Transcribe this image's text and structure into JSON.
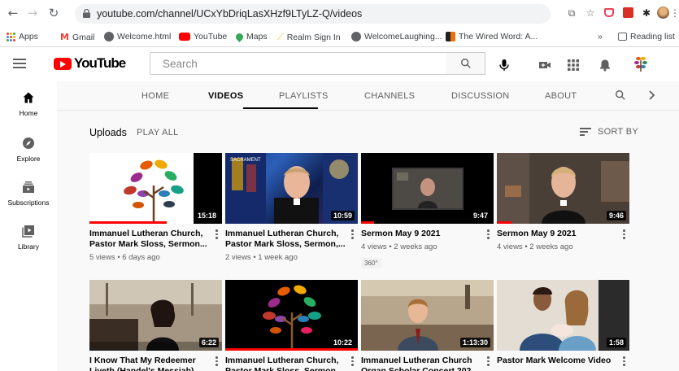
{
  "browser": {
    "url": "youtube.com/channel/UCxYbDriqLasXHzf9LTyLZ-Q/videos",
    "bookmarks": [
      {
        "label": "Apps",
        "color": "#4285f4"
      },
      {
        "label": "Gmail",
        "color": "#ea4335"
      },
      {
        "label": "Welcome.html",
        "color": "#5f6368"
      },
      {
        "label": "YouTube",
        "color": "#ff0000"
      },
      {
        "label": "Maps",
        "color": "#34a853"
      },
      {
        "label": "Realm Sign In",
        "color": "#fbbc04"
      },
      {
        "label": "WelcomeLaughing...",
        "color": "#5f6368"
      },
      {
        "label": "The Wired Word: A...",
        "color": "#e8710a"
      }
    ],
    "more_bookmarks": "»",
    "reading_list": "Reading list"
  },
  "youtube": {
    "logo_text": "YouTube",
    "search_placeholder": "Search",
    "sidebar": [
      {
        "label": "Home",
        "icon": "home-icon"
      },
      {
        "label": "Explore",
        "icon": "compass-icon"
      },
      {
        "label": "Subscriptions",
        "icon": "subscriptions-icon"
      },
      {
        "label": "Library",
        "icon": "library-icon"
      }
    ],
    "tabs": [
      {
        "label": "HOME",
        "active": false
      },
      {
        "label": "VIDEOS",
        "active": true
      },
      {
        "label": "PLAYLISTS",
        "active": false
      },
      {
        "label": "CHANNELS",
        "active": false
      },
      {
        "label": "DISCUSSION",
        "active": false
      },
      {
        "label": "ABOUT",
        "active": false
      }
    ],
    "section_title": "Uploads",
    "play_all": "PLAY ALL",
    "sort_by": "SORT BY",
    "videos": [
      {
        "title": "Immanuel Lutheran Church, Pastor Mark Sloss, Sermon...",
        "meta": "5 views • 6 days ago",
        "duration": "15:18",
        "watched": 0.58,
        "badge": ""
      },
      {
        "title": "Immanuel Lutheran Church, Pastor Mark Sloss, Sermon,...",
        "meta": "2 views • 1 week ago",
        "duration": "10:59",
        "watched": 0.0,
        "badge": ""
      },
      {
        "title": "Sermon May 9 2021",
        "meta": "4 views • 2 weeks ago",
        "duration": "9:47",
        "watched": 0.1,
        "badge": "360°"
      },
      {
        "title": "Sermon May 9 2021",
        "meta": "4 views • 2 weeks ago",
        "duration": "9:46",
        "watched": 0.11,
        "badge": ""
      },
      {
        "title": "I Know That My Redeemer Liveth (Handel's Messiah)",
        "meta": "",
        "duration": "6:22",
        "watched": 0.0,
        "badge": ""
      },
      {
        "title": "Immanuel Lutheran Church, Pastor Mark Sloss, Sermon,...",
        "meta": "",
        "duration": "10:22",
        "watched": 1.0,
        "badge": ""
      },
      {
        "title": "Immanuel Lutheran Church Organ Scholar Concert 202...",
        "meta": "",
        "duration": "1:13:30",
        "watched": 0.0,
        "badge": ""
      },
      {
        "title": "Pastor Mark Welcome Video",
        "meta": "",
        "duration": "1:58",
        "watched": 0.0,
        "badge": ""
      }
    ]
  }
}
